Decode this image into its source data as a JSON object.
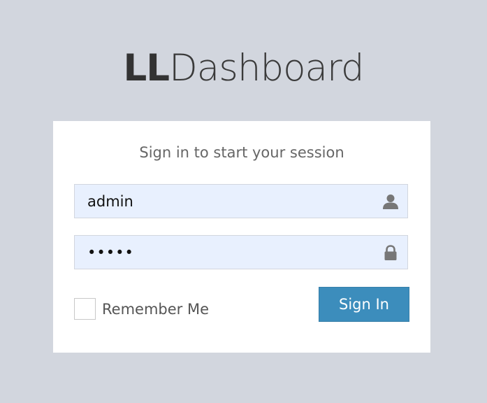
{
  "logo": {
    "bold": "LL",
    "light": "Dashboard"
  },
  "login": {
    "message": "Sign in to start your session",
    "username_value": "admin",
    "password_value": "•••••",
    "remember_label": "Remember Me",
    "remember_checked": false,
    "signin_label": "Sign In"
  },
  "icons": {
    "username": "user-icon",
    "password": "lock-icon"
  },
  "colors": {
    "background": "#d2d6de",
    "field_background": "#e8f0fe",
    "primary_button": "#3c8dbc"
  }
}
